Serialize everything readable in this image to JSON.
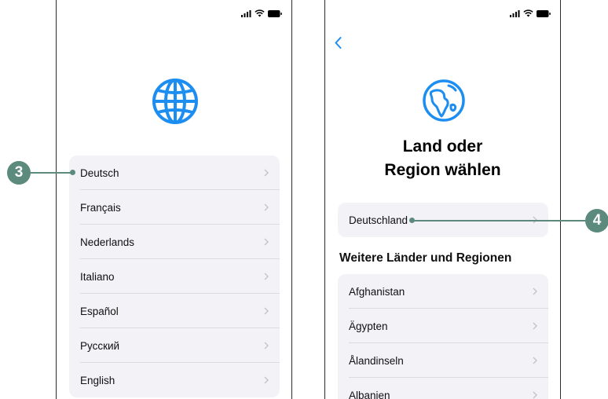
{
  "colors": {
    "accent": "#1c8ef2",
    "callout": "#5c8a7d",
    "list_bg": "#f2f2f7"
  },
  "left_screen": {
    "icon": "globe-icon",
    "languages": [
      {
        "label": "Deutsch"
      },
      {
        "label": "Français"
      },
      {
        "label": "Nederlands"
      },
      {
        "label": "Italiano"
      },
      {
        "label": "Español"
      },
      {
        "label": "Русский"
      },
      {
        "label": "English"
      }
    ]
  },
  "right_screen": {
    "icon": "earth-icon",
    "title_line1": "Land oder",
    "title_line2": "Region wählen",
    "suggested": "Deutschland",
    "section_header": "Weitere Länder und Regionen",
    "countries": [
      {
        "label": "Afghanistan"
      },
      {
        "label": "Ägypten"
      },
      {
        "label": "Ålandinseln"
      },
      {
        "label": "Albanien"
      }
    ]
  },
  "callouts": {
    "left_number": "3",
    "right_number": "4"
  }
}
